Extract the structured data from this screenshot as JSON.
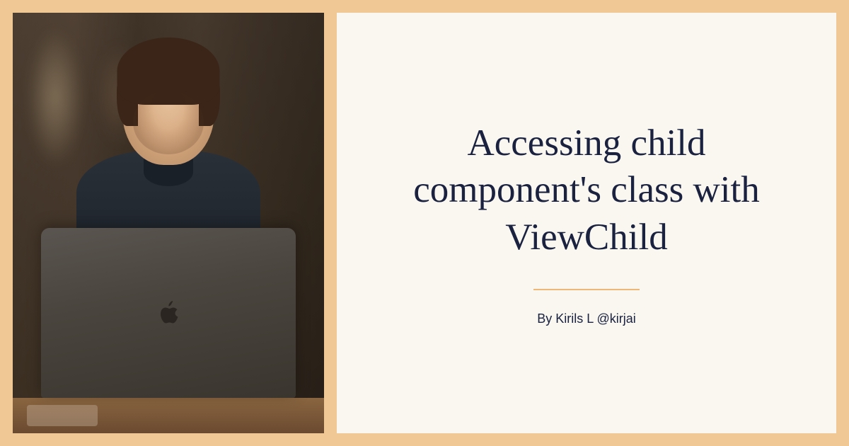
{
  "card": {
    "title": "Accessing child component's class with ViewChild",
    "byline": "By Kirils L @kirjai"
  },
  "colors": {
    "frame": "#f0c896",
    "panel": "#faf7f0",
    "text": "#1a2240",
    "divider": "#f0b878"
  }
}
